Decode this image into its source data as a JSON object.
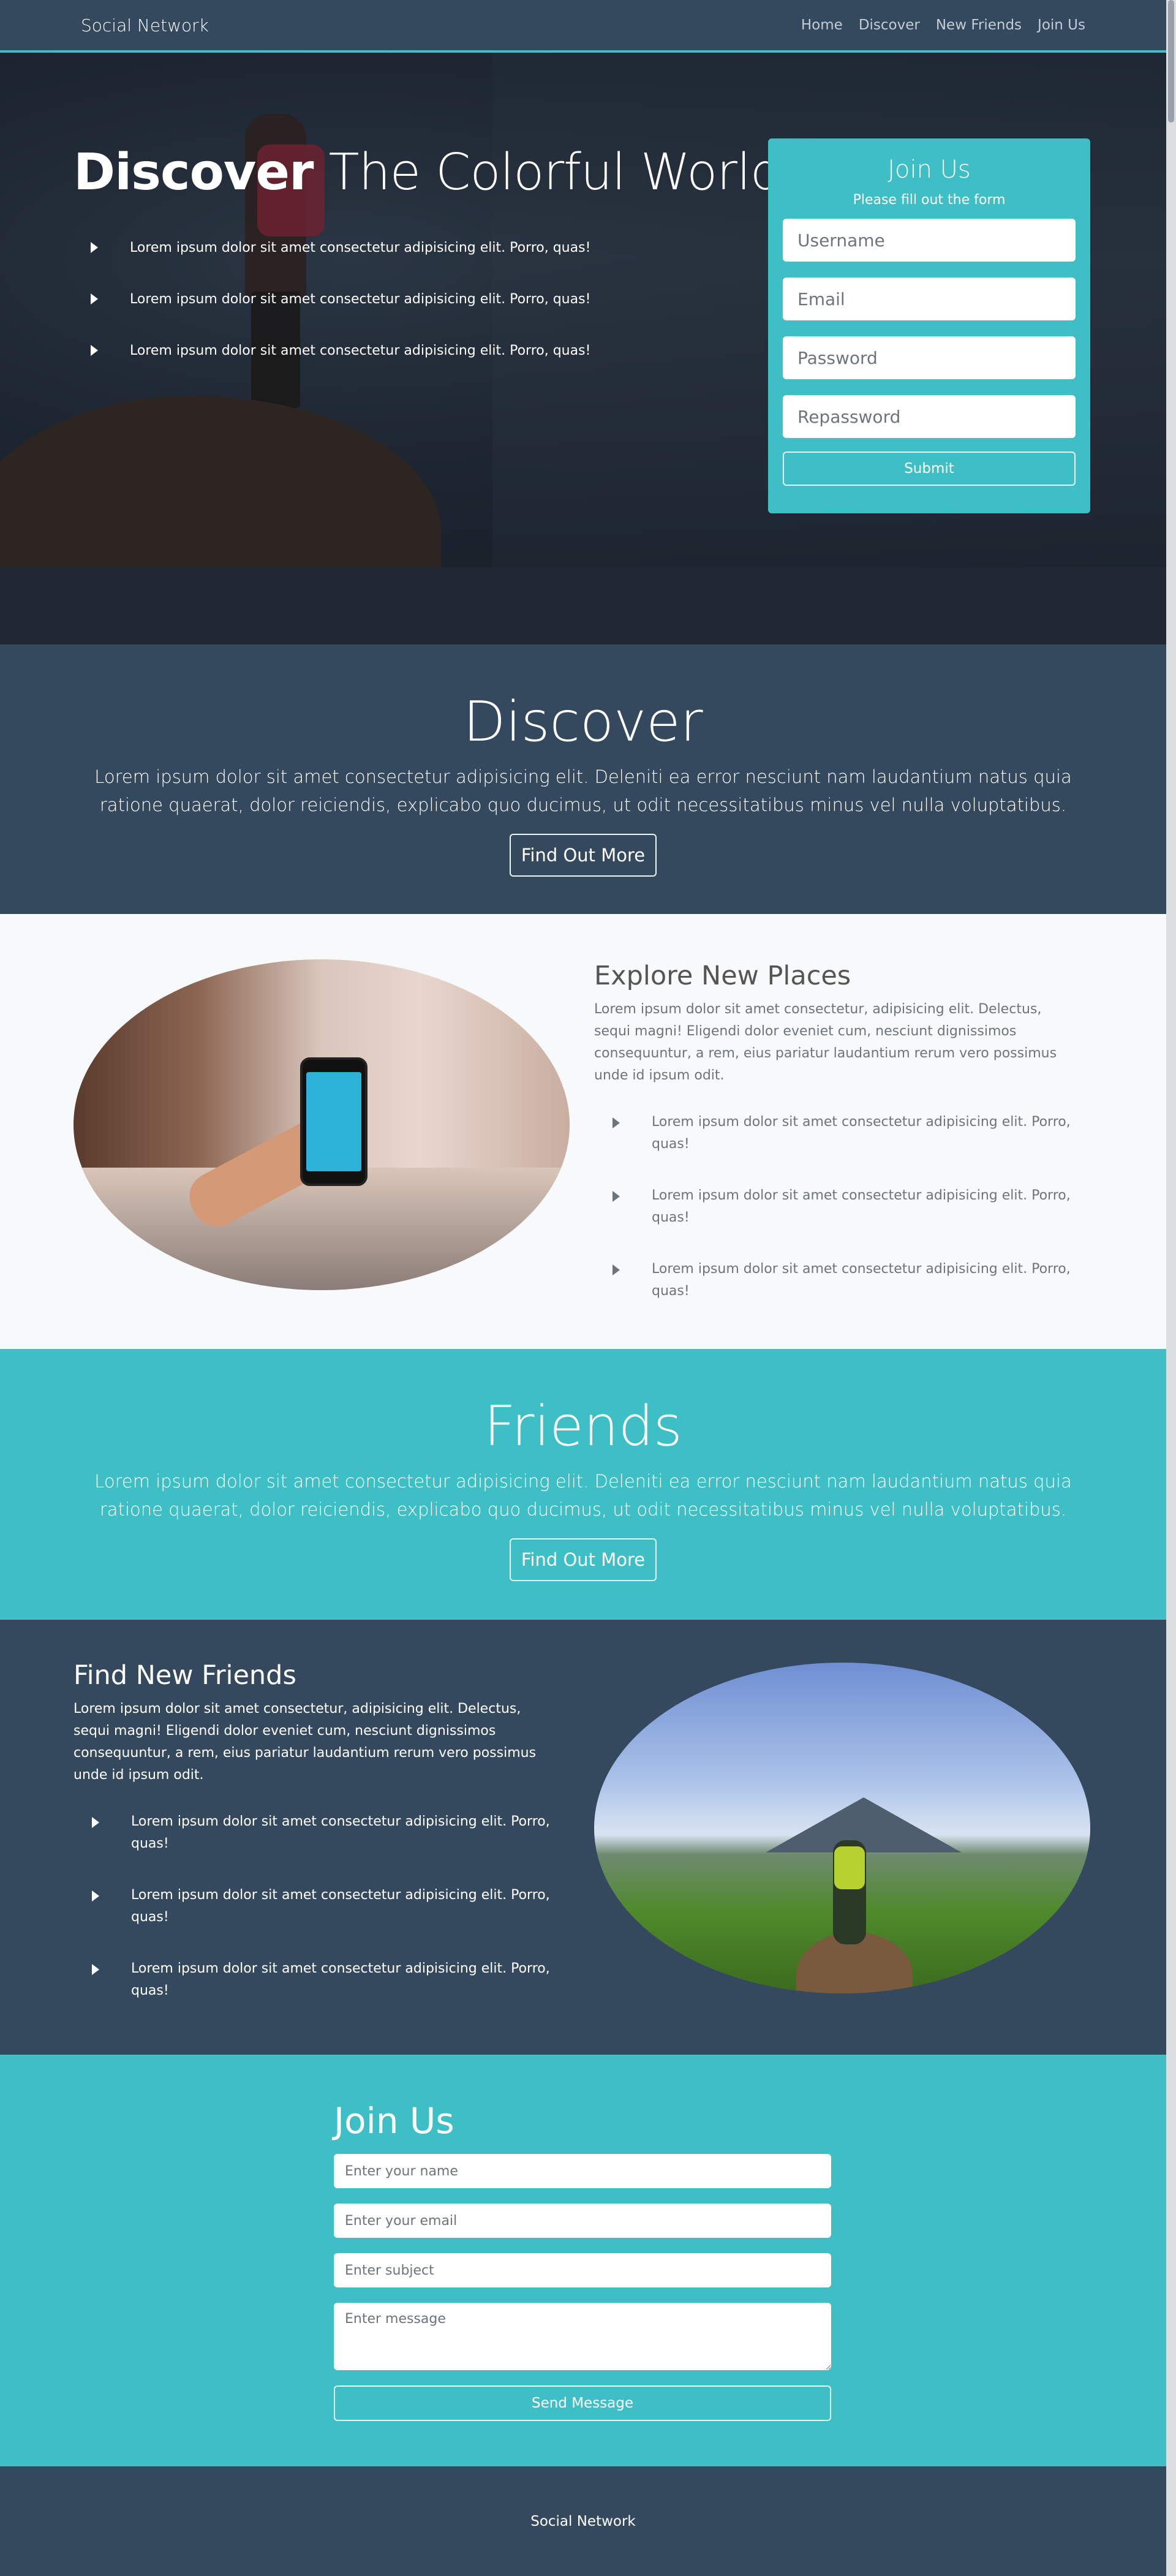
{
  "nav": {
    "brand": "Social Network",
    "links": [
      "Home",
      "Discover",
      "New Friends",
      "Join Us"
    ]
  },
  "hero": {
    "title_bold": "Discover",
    "title_rest": " The Colorful World",
    "bullets": [
      "Lorem ipsum dolor sit amet consectetur adipisicing elit. Porro, quas!",
      "Lorem ipsum dolor sit amet consectetur adipisicing elit. Porro, quas!",
      "Lorem ipsum dolor sit amet consectetur adipisicing elit. Porro, quas!"
    ]
  },
  "join_card": {
    "title": "Join Us",
    "subtitle": "Please fill out the form",
    "username_placeholder": "Username",
    "email_placeholder": "Email",
    "password_placeholder": "Password",
    "repassword_placeholder": "Repassword",
    "submit_label": "Submit"
  },
  "discover": {
    "heading": "Discover",
    "text": "Lorem ipsum dolor sit amet consectetur adipisicing elit. Deleniti ea error nesciunt nam laudantium natus quia ratione quaerat, dolor reiciendis, explicabo quo ducimus, ut odit necessitatibus minus vel nulla voluptatibus.",
    "button_label": "Find Out More"
  },
  "explore": {
    "heading": "Explore New Places",
    "text": "Lorem ipsum dolor sit amet consectetur, adipisicing elit. Delectus, sequi magni! Eligendi dolor eveniet cum, nesciunt dignissimos consequuntur, a rem, eius pariatur laudantium rerum vero possimus unde id ipsum odit.",
    "bullets": [
      "Lorem ipsum dolor sit amet consectetur adipisicing elit. Porro, quas!",
      "Lorem ipsum dolor sit amet consectetur adipisicing elit. Porro, quas!",
      "Lorem ipsum dolor sit amet consectetur adipisicing elit. Porro, quas!"
    ]
  },
  "friends": {
    "heading": "Friends",
    "text": "Lorem ipsum dolor sit amet consectetur adipisicing elit. Deleniti ea error nesciunt nam laudantium natus quia ratione quaerat, dolor reiciendis, explicabo quo ducimus, ut odit necessitatibus minus vel nulla voluptatibus.",
    "button_label": "Find Out More"
  },
  "find_friends": {
    "heading": "Find New Friends",
    "text": "Lorem ipsum dolor sit amet consectetur, adipisicing elit. Delectus, sequi magni! Eligendi dolor eveniet cum, nesciunt dignissimos consequuntur, a rem, eius pariatur laudantium rerum vero possimus unde id ipsum odit.",
    "bullets": [
      "Lorem ipsum dolor sit amet consectetur adipisicing elit. Porro, quas!",
      "Lorem ipsum dolor sit amet consectetur adipisicing elit. Porro, quas!",
      "Lorem ipsum dolor sit amet consectetur adipisicing elit. Porro, quas!"
    ]
  },
  "contact": {
    "heading": "Join Us",
    "name_placeholder": "Enter your name",
    "email_placeholder": "Enter your email",
    "subject_placeholder": "Enter subject",
    "message_placeholder": "Enter message",
    "send_label": "Send Message"
  },
  "footer": {
    "text": "Social Network"
  },
  "colors": {
    "primary_dark": "#34495e",
    "accent_teal": "#3ebfc6",
    "light_bg": "#f8f9fa"
  },
  "icons": {
    "bullet": "caret-right-icon"
  }
}
